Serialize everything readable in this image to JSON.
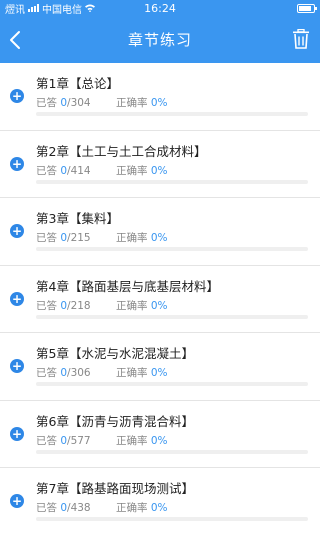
{
  "status_bar": {
    "carrier_prefix": "熤讯",
    "carrier": "中国电信",
    "time": "16:24"
  },
  "header": {
    "title": "章节练习",
    "back_icon": "chevron-left-icon",
    "trash_icon": "trash-icon"
  },
  "labels": {
    "answered": "已答",
    "accuracy": "正确率"
  },
  "colors": {
    "primary": "#3a96f0",
    "icon": "#2e87e6"
  },
  "chapters": [
    {
      "title": "第1章【总论】",
      "answered": "0",
      "total": "/304",
      "accuracy": "0%",
      "progress": 0
    },
    {
      "title": "第2章【土工与土工合成材料】",
      "answered": "0",
      "total": "/414",
      "accuracy": "0%",
      "progress": 0
    },
    {
      "title": "第3章【集料】",
      "answered": "0",
      "total": "/215",
      "accuracy": "0%",
      "progress": 0
    },
    {
      "title": "第4章【路面基层与底基层材料】",
      "answered": "0",
      "total": "/218",
      "accuracy": "0%",
      "progress": 0
    },
    {
      "title": "第5章【水泥与水泥混凝土】",
      "answered": "0",
      "total": "/306",
      "accuracy": "0%",
      "progress": 0
    },
    {
      "title": "第6章【沥青与沥青混合料】",
      "answered": "0",
      "total": "/577",
      "accuracy": "0%",
      "progress": 0
    },
    {
      "title": "第7章【路基路面现场测试】",
      "answered": "0",
      "total": "/438",
      "accuracy": "0%",
      "progress": 0
    }
  ]
}
